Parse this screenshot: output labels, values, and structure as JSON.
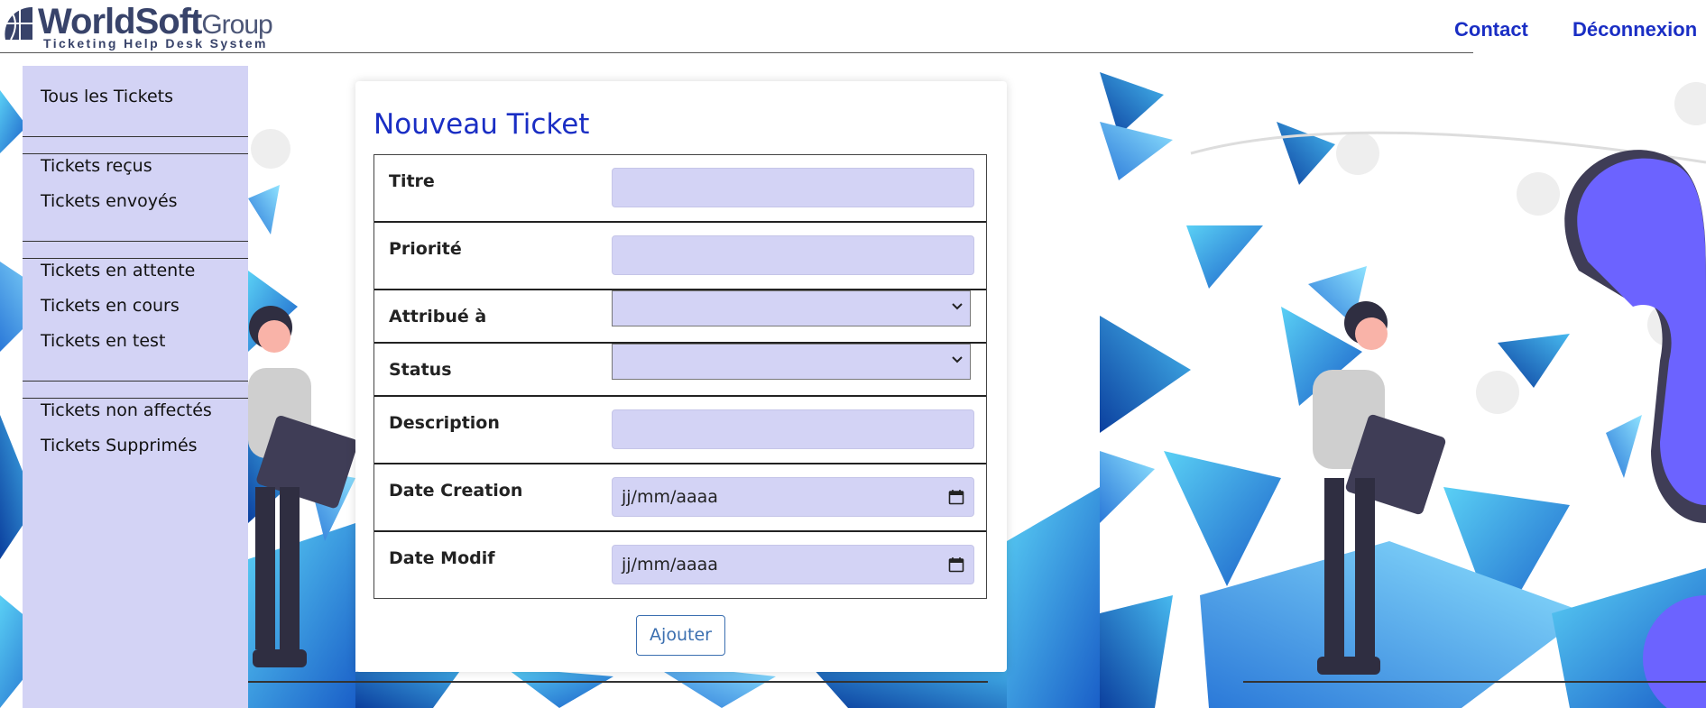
{
  "header": {
    "logo_name_bold": "WorldSoft",
    "logo_name_light": "Group",
    "logo_subtitle": "Ticketing Help Desk System",
    "nav": {
      "contact": "Contact",
      "logout": "Déconnexion"
    }
  },
  "sidebar": {
    "groups": [
      [
        "Tous les Tickets"
      ],
      [
        "Tickets reçus",
        "Tickets envoyés"
      ],
      [
        "Tickets en attente",
        "Tickets en cours",
        "Tickets en test"
      ],
      [
        "Tickets non affectés",
        "Tickets Supprimés"
      ]
    ]
  },
  "form": {
    "title": "Nouveau Ticket",
    "fields": {
      "titre": {
        "label": "Titre",
        "value": ""
      },
      "priorite": {
        "label": "Priorité",
        "value": ""
      },
      "attribue": {
        "label": "Attribué à",
        "value": ""
      },
      "status": {
        "label": "Status",
        "value": ""
      },
      "description": {
        "label": "Description",
        "value": ""
      },
      "date_creation": {
        "label": "Date Creation",
        "placeholder": "jj/mm/aaaa"
      },
      "date_modif": {
        "label": "Date Modif",
        "placeholder": "jj/mm/aaaa"
      }
    },
    "submit_label": "Ajouter"
  },
  "colors": {
    "brand_blue": "#1a2ec4",
    "field_bg": "#d3d3f5",
    "button_blue": "#3b6fb0",
    "logo_navy": "#38436a"
  },
  "icons": [
    "globe-logo-icon",
    "chevron-down-icon",
    "calendar-icon"
  ]
}
